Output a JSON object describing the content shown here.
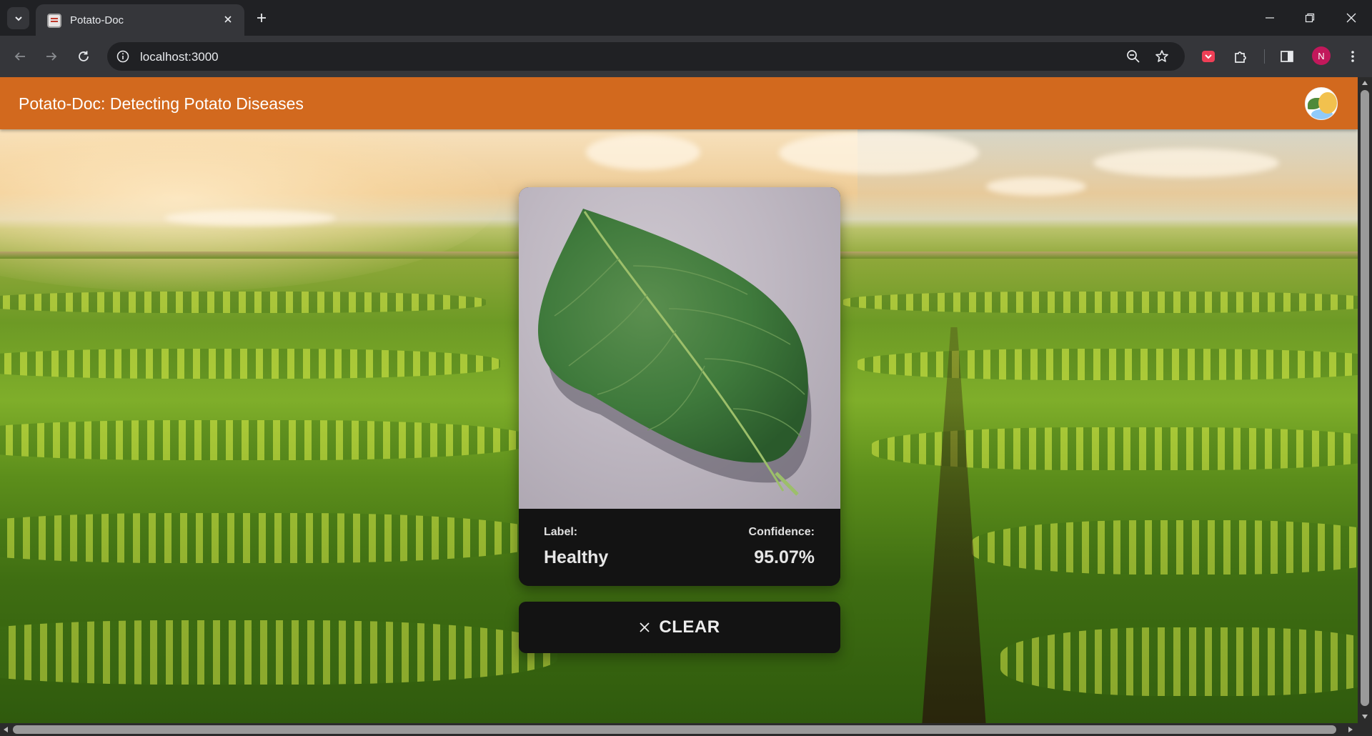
{
  "browser": {
    "tab_title": "Potato-Doc",
    "url": "localhost:3000",
    "profile_initial": "N"
  },
  "app": {
    "title": "Potato-Doc: Detecting Potato Diseases",
    "avatar_icon": "potato-doctor-avatar"
  },
  "result": {
    "label_caption": "Label:",
    "label_value": "Healthy",
    "confidence_caption": "Confidence:",
    "confidence_value": "95.07%"
  },
  "actions": {
    "clear_label": "CLEAR"
  },
  "colors": {
    "header": "#d2691e",
    "card": "#131313",
    "leaf": "#3f7a3c"
  }
}
